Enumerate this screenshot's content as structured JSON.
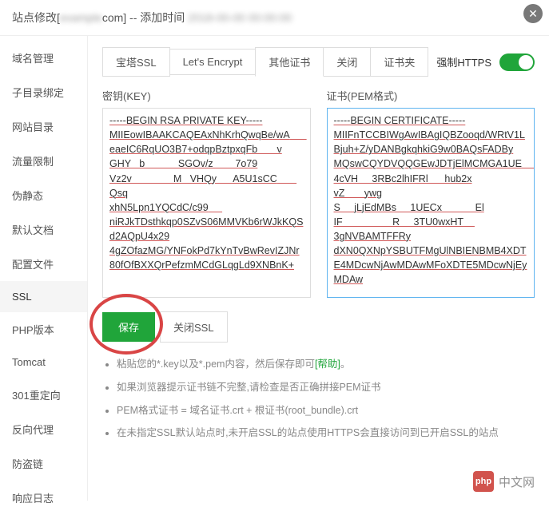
{
  "header": {
    "prefix": "站点修改[",
    "domain_suffix": "com] -- 添加时间",
    "close": "✕"
  },
  "sidebar": {
    "items": [
      "域名管理",
      "子目录绑定",
      "网站目录",
      "流量限制",
      "伪静态",
      "默认文档",
      "配置文件",
      "SSL",
      "PHP版本",
      "Tomcat",
      "301重定向",
      "反向代理",
      "防盗链",
      "响应日志"
    ],
    "active_index": 7
  },
  "tabs": {
    "items": [
      "宝塔SSL",
      "Let's Encrypt",
      "其他证书",
      "关闭",
      "证书夹"
    ],
    "active_index": 2,
    "force_https_label": "强制HTTPS"
  },
  "fields": {
    "key_label": "密钥(KEY)",
    "cert_label": "证书(PEM格式)",
    "key_value": "-----BEGIN RSA PRIVATE KEY-----\nMIIEowIBAAKCAQEAxNhKrhQwqBe/wA      eaeIC6RqUO3B7+odqpBztpxqFb       v\nGHY   b            SGOv/z        7o79\nVz2v               M   VHQy      A5U1sCC       Qsq\nxhN5Lpn1YQCdC/c99     niRJkTDsthkqp0SZvS06MMVKb6rWJkKQSd2AQpU4x29\n4gZOfazMG/YNFokPd7kYnTvBwRevIZJNr80fOfBXXQrPefzmMCdGLqgLd9XNBnK+",
    "cert_value": "-----BEGIN CERTIFICATE-----\nMIIFnTCCBIWgAwIBAgIQBZooqd/WRtV1LBjuh+Z/yDANBgkqhkiG9w0BAQsFADBy\nMQswCQYDVQQGEwJDTjElMCMGA1UE        4cVH     3RBc2lhIFRl      hub2x\nvZ       ywg\nS     jLjEdMBs     1UECx            El\nIF                  R     3TU0wxHT    3gNVBAMTFFRy\ndXN0QXNpYSBUTFMgUlNBIENBMB4XDTE4MDcwNjAwMDAwMFoXDTE5MDcwNjEyMDAw"
  },
  "buttons": {
    "save": "保存",
    "close_ssl": "关闭SSL"
  },
  "tips": {
    "t1_pre": "粘贴您的*.key以及*.pem内容，然后保存即可",
    "t1_link": "[帮助]",
    "t1_post": "。",
    "t2": "如果浏览器提示证书链不完整,请检查是否正确拼接PEM证书",
    "t3": "PEM格式证书 = 域名证书.crt + 根证书(root_bundle).crt",
    "t4": "在未指定SSL默认站点时,未开启SSL的站点使用HTTPS会直接访问到已开启SSL的站点"
  },
  "watermark": {
    "logo": "php",
    "text": "中文网"
  }
}
